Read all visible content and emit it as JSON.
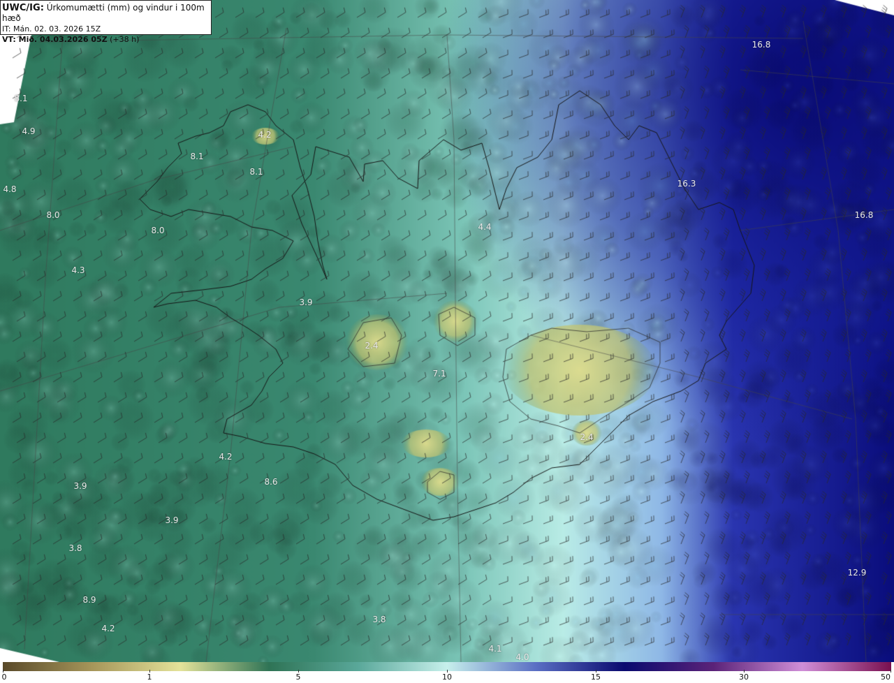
{
  "title": {
    "model": "UWC/IG:",
    "product": "Úrkomumætti (mm) og vindur i 100m hæð",
    "init_time": "IT: Mán. 02. 03. 2026 15Z",
    "valid_label": "VT: Mið. 04.03.2026 05Z",
    "lead": "(+38 h)"
  },
  "map_labels": [
    {
      "text": "16.8"
    },
    {
      "text": "8.1"
    },
    {
      "text": "4.9"
    },
    {
      "text": "4.2"
    },
    {
      "text": "8.1"
    },
    {
      "text": "8.1"
    },
    {
      "text": "4.8"
    },
    {
      "text": "8.0"
    },
    {
      "text": "8.0"
    },
    {
      "text": "16.3"
    },
    {
      "text": "16.8"
    },
    {
      "text": "4.4"
    },
    {
      "text": "4.3"
    },
    {
      "text": "3.9"
    },
    {
      "text": "2.4"
    },
    {
      "text": "7.1"
    },
    {
      "text": "2.4"
    },
    {
      "text": "4.2"
    },
    {
      "text": "3.9"
    },
    {
      "text": "8.6"
    },
    {
      "text": "3.9"
    },
    {
      "text": "3.8"
    },
    {
      "text": "8.9"
    },
    {
      "text": "12.9"
    },
    {
      "text": "3.8"
    },
    {
      "text": "4.2"
    },
    {
      "text": "4.1"
    },
    {
      "text": "4.0"
    }
  ],
  "colorbar": {
    "labels": [
      "0",
      "1",
      "5",
      "10",
      "15",
      "30",
      "50"
    ],
    "stops": [
      "#5a4a2a",
      "#a6965a",
      "#e4e39a",
      "#2f7456",
      "#5aa89a",
      "#c7f0ec",
      "#5b6fc4",
      "#0a0a6f",
      "#5b2379",
      "#d08fd8",
      "#7a1050"
    ]
  },
  "colors": {
    "land_low": "#e7e49a",
    "land_mid": "#3b7f63",
    "sea_light": "#bfeeea",
    "sea_deep": "#0f1386"
  }
}
